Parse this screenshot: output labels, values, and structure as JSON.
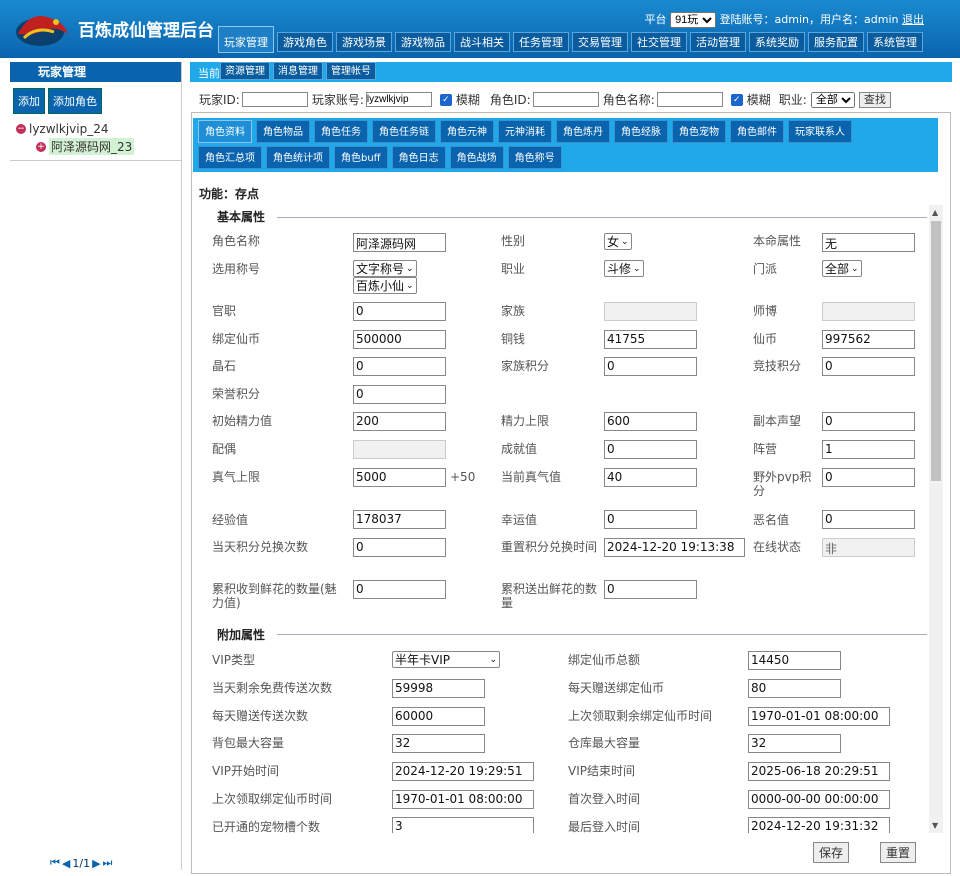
{
  "header": {
    "title": "百炼成仙管理后台",
    "platform_label": "平台",
    "platform_value": "91玩",
    "login_info": "登陆账号：admin，用户名：admin",
    "logout": "退出"
  },
  "nav1": [
    "玩家管理",
    "游戏角色",
    "游戏场景",
    "游戏物品",
    "战斗相关",
    "任务管理",
    "交易管理",
    "社交管理",
    "活动管理",
    "系统奖励",
    "服务配置",
    "系统管理"
  ],
  "nav2": [
    "资源管理",
    "消息管理",
    "管理帐号"
  ],
  "left": {
    "title": "玩家管理",
    "add": "添加",
    "add_role": "添加角色",
    "node1": "lyzwlkjvip_24",
    "node2": "阿泽源码网_23",
    "pager": "1/1"
  },
  "main": {
    "current": "当前"
  },
  "search": {
    "player_id": "玩家ID:",
    "player_account": "玩家账号:",
    "account_value": "lyzwlkjvip",
    "fuzzy1": "模糊",
    "role_id": "角色ID:",
    "role_name": "角色名称:",
    "fuzzy2": "模糊",
    "job": "职业:",
    "job_value": "全部",
    "search_btn": "查找"
  },
  "tabs_row1": [
    "角色资料",
    "角色物品",
    "角色任务",
    "角色任务链",
    "角色元神",
    "元神消耗",
    "角色炼丹",
    "角色经脉",
    "角色宠物",
    "角色邮件",
    "玩家联系人"
  ],
  "tabs_row2": [
    "角色汇总项",
    "角色统计项",
    "角色buff",
    "角色日志",
    "角色战场",
    "角色称号"
  ],
  "func": "功能：存点",
  "basic": {
    "title": "基本属性",
    "role_name": "角色名称",
    "role_name_v": "阿泽源码网",
    "gender": "性别",
    "gender_v": "女",
    "life_attr": "本命属性",
    "life_attr_v": "无",
    "sel_title": "选用称号",
    "title_type_v": "文字称号",
    "title_v": "百炼小仙",
    "job": "职业",
    "job_v": "斗修",
    "sect": "门派",
    "sect_v": "全部",
    "official": "官职",
    "official_v": "0",
    "family": "家族",
    "master": "师博",
    "bind_coin": "绑定仙币",
    "bind_coin_v": "500000",
    "copper": "铜钱",
    "copper_v": "41755",
    "coin": "仙币",
    "coin_v": "997562",
    "crystal": "晶石",
    "crystal_v": "0",
    "family_pts": "家族积分",
    "family_pts_v": "0",
    "arena_pts": "竞技积分",
    "arena_pts_v": "0",
    "honor": "荣誉积分",
    "honor_v": "0",
    "init_energy": "初始精力值",
    "init_energy_v": "200",
    "energy_max": "精力上限",
    "energy_max_v": "600",
    "dungeon_fame": "副本声望",
    "dungeon_fame_v": "0",
    "spouse": "配偶",
    "achieve": "成就值",
    "achieve_v": "0",
    "camp": "阵营",
    "camp_v": "1",
    "qi_max": "真气上限",
    "qi_max_v": "5000",
    "qi_plus": "+50",
    "cur_qi": "当前真气值",
    "cur_qi_v": "40",
    "pvp": "野外pvp积分",
    "pvp_v": "0",
    "exp": "经验值",
    "exp_v": "178037",
    "luck": "幸运值",
    "luck_v": "0",
    "evil": "恶名值",
    "evil_v": "0",
    "exchange_cnt": "当天积分兑换次数",
    "exchange_cnt_v": "0",
    "reset_time": "重置积分兑换时间",
    "reset_time_v": "2024-12-20 19:13:38",
    "online": "在线状态",
    "online_v": "非",
    "flowers_recv": "累积收到鲜花的数量(魅力值)",
    "flowers_recv_v": "0",
    "flowers_sent": "累积送出鲜花的数量",
    "flowers_sent_v": "0"
  },
  "extra": {
    "title": "附加属性",
    "vip_type": "VIP类型",
    "vip_type_v": "半年卡VIP",
    "bind_total": "绑定仙币总额",
    "bind_total_v": "14450",
    "free_tp": "当天剩余免费传送次数",
    "free_tp_v": "59998",
    "daily_bind": "每天赠送绑定仙币",
    "daily_bind_v": "80",
    "daily_tp": "每天赠送传送次数",
    "daily_tp_v": "60000",
    "last_remain": "上次领取剩余绑定仙币时间",
    "last_remain_v": "1970-01-01 08:00:00",
    "bag_max": "背包最大容量",
    "bag_max_v": "32",
    "store_max": "仓库最大容量",
    "store_max_v": "32",
    "vip_start": "VIP开始时间",
    "vip_start_v": "2024-12-20 19:29:51",
    "vip_end": "VIP结束时间",
    "vip_end_v": "2025-06-18 20:29:51",
    "last_bind": "上次领取绑定仙币时间",
    "last_bind_v": "1970-01-01 08:00:00",
    "first_login": "首次登入时间",
    "first_login_v": "0000-00-00 00:00:00",
    "pet_slots": "已开通的宠物槽个数",
    "pet_slots_v": "3",
    "last_login": "最后登入时间",
    "last_login_v": "2024-12-20 19:31:32"
  },
  "buttons": {
    "save": "保存",
    "reset": "重置"
  }
}
